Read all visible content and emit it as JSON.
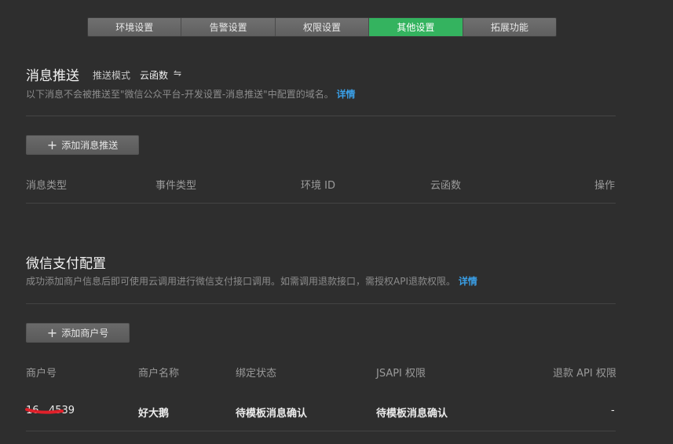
{
  "tabs": [
    {
      "label": "环境设置",
      "active": false
    },
    {
      "label": "告警设置",
      "active": false
    },
    {
      "label": "权限设置",
      "active": false
    },
    {
      "label": "其他设置",
      "active": true
    },
    {
      "label": "拓展功能",
      "active": false
    }
  ],
  "push": {
    "title": "消息推送",
    "mode_label": "推送模式",
    "mode_value": "云函数",
    "mode_icon": "swap-icon",
    "description": "以下消息不会被推送至\"微信公众平台-开发设置-消息推送\"中配置的域名。",
    "detail_link": "详情",
    "add_button": "添加消息推送",
    "columns": [
      "消息类型",
      "事件类型",
      "环境 ID",
      "云函数",
      "操作"
    ]
  },
  "pay": {
    "title": "微信支付配置",
    "description": "成功添加商户信息后即可使用云调用进行微信支付接口调用。如需调用退款接口，需授权API退款权限。",
    "detail_link": "详情",
    "add_button": "添加商户号",
    "columns": [
      "商户号",
      "商户名称",
      "绑定状态",
      "JSAPI 权限",
      "退款 API 权限"
    ],
    "rows": [
      {
        "merchant_id": "16...4539",
        "merchant_name": "好大鹅",
        "bind_status": "待模板消息确认",
        "jsapi": "待模板消息确认",
        "refund": "-"
      }
    ]
  },
  "colors": {
    "accent": "#34b35f",
    "link": "#3aa0e8",
    "background": "#2e2e2e"
  }
}
